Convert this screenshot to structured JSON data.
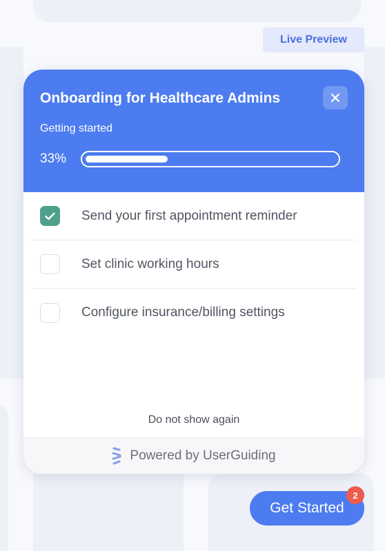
{
  "live_preview": {
    "label": "Live Preview"
  },
  "checklist": {
    "title": "Onboarding for Healthcare Admins",
    "subtitle": "Getting started",
    "progress": {
      "label": "33%",
      "value": 0.33
    },
    "tasks": [
      {
        "label": "Send your first appointment reminder",
        "completed": true
      },
      {
        "label": "Set clinic working hours",
        "completed": false
      },
      {
        "label": "Configure insurance/billing settings",
        "completed": false
      }
    ],
    "dont_show_label": "Do not show again",
    "powered_by": "Powered by UserGuiding"
  },
  "launcher": {
    "label": "Get Started",
    "badge_count": "2"
  },
  "icons": {
    "close": "close-icon",
    "check": "check-icon",
    "brand": "userguiding-logo-icon"
  },
  "colors": {
    "primary": "#4c7cf0",
    "checked": "#4fa08a",
    "badge": "#ef5b4f",
    "live_preview_bg": "#e4e9fb",
    "live_preview_text": "#4a6fe3"
  }
}
